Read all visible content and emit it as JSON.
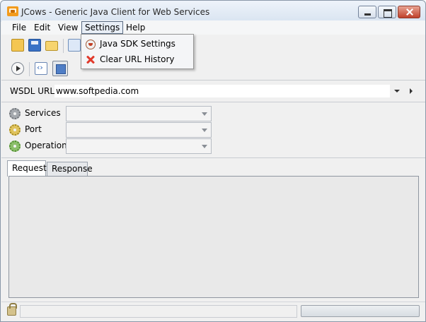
{
  "window": {
    "title": "JCows - Generic Java Client for Web Services",
    "icon": "cow-app-icon"
  },
  "menubar": {
    "items": [
      "File",
      "Edit",
      "View",
      "Settings",
      "Help"
    ],
    "active": "Settings"
  },
  "settings_menu": {
    "items": [
      {
        "label": "Java SDK Settings",
        "icon": "java-icon"
      },
      {
        "label": "Clear URL History",
        "icon": "red-x-icon"
      }
    ]
  },
  "toolbar": {
    "row1_icons": [
      "open-icon",
      "save-icon",
      "folder-icon",
      "copy-icon"
    ],
    "row2_icons": [
      "run-icon",
      "xml-icon",
      "view-toggle-icon"
    ]
  },
  "wsdl": {
    "label": "WSDL URL:",
    "value": "www.softpedia.com"
  },
  "fields": {
    "services_label": "Services",
    "port_label": "Port",
    "operation_label": "Operation"
  },
  "tabs": {
    "request": "Request",
    "response": "Response",
    "active": "Request"
  }
}
